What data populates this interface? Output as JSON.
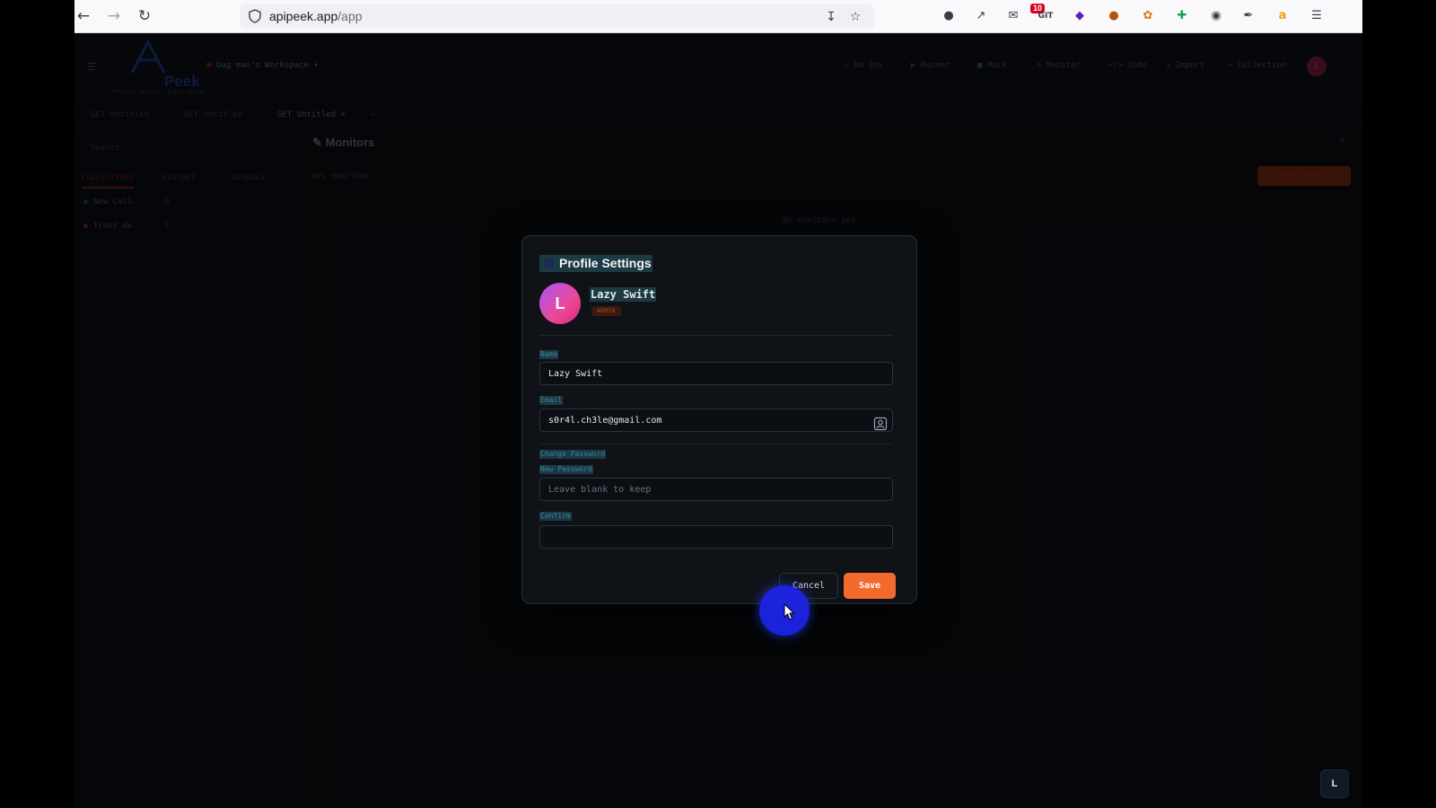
{
  "browser": {
    "url_host": "apipeek.app",
    "url_path": "/app",
    "extension_badge": "10",
    "extension_git_label": "GIT"
  },
  "app": {
    "logo_text": "Peek",
    "logo_tagline": "Preview smarter. build faster.",
    "workspace": "bug man's Workspace",
    "toolbar": {
      "env": "No Env",
      "runner": "Runner",
      "mock": "Mock",
      "monitor": "Monitor",
      "code": "Code",
      "import": "Import",
      "collection": "Collection"
    },
    "user_initial": "L",
    "request_tabs": [
      {
        "method": "GET",
        "label": "Untitled"
      },
      {
        "method": "GET",
        "label": "Untitled"
      },
      {
        "method": "GET",
        "label": "Untitled"
      }
    ],
    "sidebar": {
      "search_placeholder": "Search...",
      "tabs": [
        "COLLECTIONS",
        "HISTORY",
        "GLOBALS"
      ],
      "collections": [
        {
          "name": "New Coll...",
          "count": "0",
          "color": "#1e3a8a"
        },
        {
          "name": "front de...",
          "count": "3",
          "color": "#7c2d12"
        }
      ]
    },
    "main": {
      "title": "Monitors",
      "section_label": "API MONITORS",
      "new_monitor": "+ New Monitor",
      "empty_text": "No monitors yet."
    }
  },
  "modal": {
    "title": "Profile Settings",
    "display_name": "Lazy Swift",
    "role": "ADMIN",
    "avatar_initial": "L",
    "name_label": "Name",
    "name_value": "Lazy Swift",
    "email_label": "Email",
    "email_value": "s0r4l.ch3le@gmail.com",
    "change_password_label": "Change Password",
    "new_password_label": "New Password",
    "new_password_placeholder": "Leave blank to keep",
    "confirm_label": "Confirm",
    "confirm_value": "",
    "cancel_label": "Cancel",
    "save_label": "Save"
  },
  "colors": {
    "accent": "#f26b2d",
    "highlight": "#1b3a44",
    "cursor_highlight": "#1d25eb"
  }
}
